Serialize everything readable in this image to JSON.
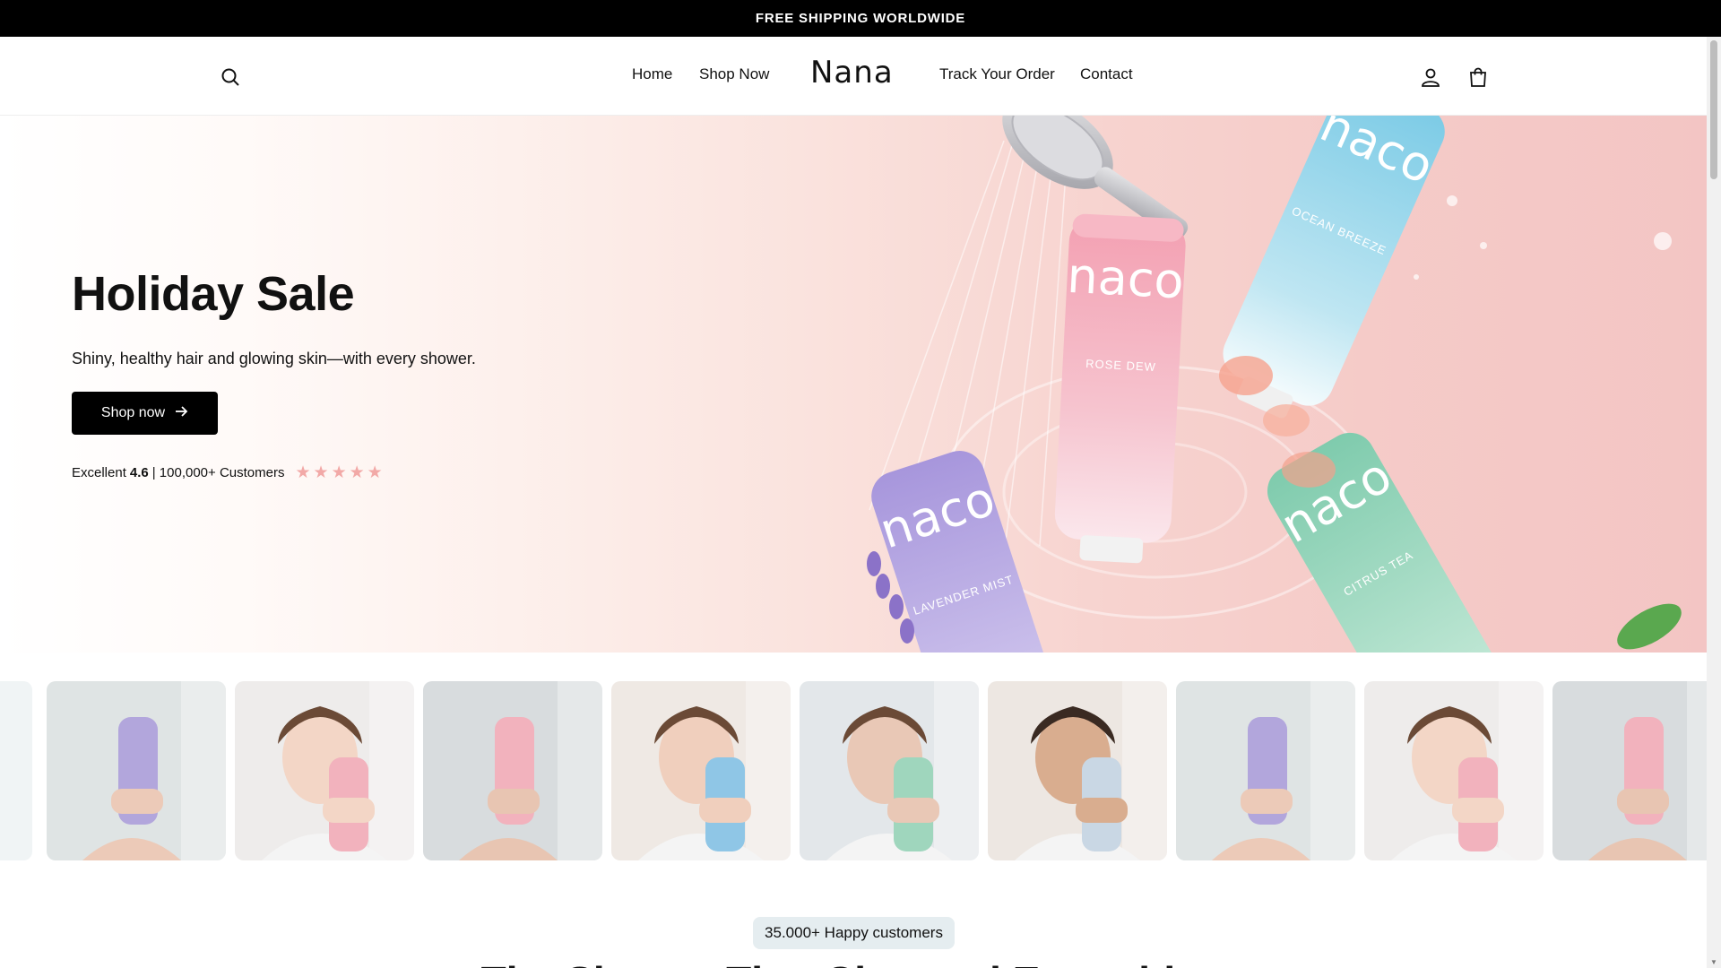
{
  "announcement": {
    "text": "FREE SHIPPING WORLDWIDE"
  },
  "header": {
    "logo": "Nana",
    "nav": [
      {
        "label": "Home"
      },
      {
        "label": "Shop Now"
      },
      {
        "label": "Track Your Order"
      },
      {
        "label": "Contact"
      }
    ],
    "icons": [
      "search-icon",
      "account-icon",
      "cart-icon"
    ]
  },
  "hero": {
    "title": "Holiday Sale",
    "subtitle": "Shiny, healthy hair and glowing skin—with every shower.",
    "button_label": "Shop now",
    "rating": {
      "prefix": "Excellent",
      "score": "4.6",
      "suffix": "| 100,000+ Customers",
      "stars": 5
    },
    "products": [
      {
        "brand": "naco",
        "name": "ROSE DEW",
        "color": "#f2a6b4"
      },
      {
        "brand": "naco",
        "name": "OCEAN BREEZE",
        "color": "#8fd3e8"
      },
      {
        "brand": "naco",
        "name": "LAVENDER MIST",
        "color": "#b7a6e0"
      },
      {
        "brand": "naco",
        "name": "CITRUS TEA",
        "color": "#8fd1b5"
      }
    ]
  },
  "gallery": {
    "tiles": [
      {
        "product_color": "#f2b2bd"
      },
      {
        "product_color": "#b2a6dc"
      },
      {
        "product_color": "#f2b2bd"
      },
      {
        "product_color": "#f2b2bd"
      },
      {
        "product_color": "#8fc6e6"
      },
      {
        "product_color": "#9fd6bd"
      },
      {
        "product_color": "#c9d7e4"
      },
      {
        "product_color": "#b2a6dc"
      },
      {
        "product_color": "#f2b2bd"
      },
      {
        "product_color": "#f2b2bd"
      }
    ]
  },
  "social_proof": {
    "badge": "35.000+ Happy customers",
    "heading": "The Shower That Changed Everything"
  },
  "colors": {
    "accent": "#000000",
    "star": "#f2a9a7",
    "badge_bg": "#e5edf0",
    "hero_pink": "#f5cbc8"
  }
}
